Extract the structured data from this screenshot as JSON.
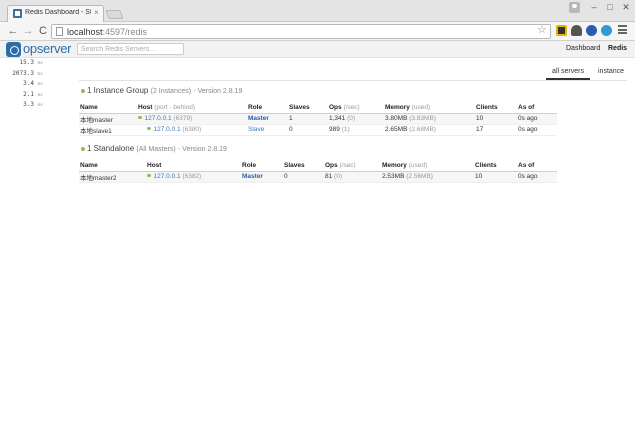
{
  "browser": {
    "tab_title": "Redis Dashboard - Stac",
    "tab_close": "×",
    "url_host": "localhost",
    "url_path": ":4597/redis",
    "win_min": "–",
    "win_max": "□",
    "win_close": "✕",
    "nav_back": "←",
    "nav_forward": "→",
    "nav_reload": "C",
    "star": "☆"
  },
  "header": {
    "logo_text": "opserver",
    "search_placeholder": "Search Redis Servers...",
    "nav": {
      "dashboard": "Dashboard",
      "redis": "Redis"
    }
  },
  "stats": [
    {
      "value": "15.3",
      "unit": "ms"
    },
    {
      "value": "2073.3",
      "unit": "ms"
    },
    {
      "value": "3.4",
      "unit": "ms"
    },
    {
      "value": "2.1",
      "unit": "ms"
    },
    {
      "value": "3.3",
      "unit": "ms"
    }
  ],
  "view_tabs": {
    "all": "all servers",
    "instance": "instance"
  },
  "groups": [
    {
      "title": "1 Instance Group",
      "subtitle": "(2 Instances)",
      "version": "- Version 2.8.19",
      "columns": {
        "name": "Name",
        "host": "Host",
        "host_sub": "(port - behind)",
        "role": "Role",
        "slaves": "Slaves",
        "ops": "Ops",
        "ops_sub": "(/sec)",
        "memory": "Memory",
        "memory_sub": "(used)",
        "clients": "Clients",
        "as_of": "As of"
      },
      "rows": [
        {
          "name": "本地master",
          "host": "127.0.0.1",
          "port": "(6379)",
          "role": "Master",
          "slaves": "1",
          "ops": "1,341",
          "ops_sub": "(0)",
          "memory": "3.80MB",
          "memory_sub": "(3.83MB)",
          "clients": "10",
          "as_of": "0s ago"
        },
        {
          "name": "本地slave1",
          "host": "127.0.0.1",
          "port": "(6380)",
          "role": "Slave",
          "slaves": "0",
          "ops": "989",
          "ops_sub": "(1)",
          "memory": "2.65MB",
          "memory_sub": "(2.68MB)",
          "clients": "17",
          "as_of": "0s ago"
        }
      ]
    },
    {
      "title": "1 Standalone",
      "subtitle": "(All Masters)",
      "version": "- Version 2.8.19",
      "columns": {
        "name": "Name",
        "host": "Host",
        "role": "Role",
        "slaves": "Slaves",
        "ops": "Ops",
        "ops_sub": "(/sec)",
        "memory": "Memory",
        "memory_sub": "(used)",
        "clients": "Clients",
        "as_of": "As of"
      },
      "rows": [
        {
          "name": "本地master2",
          "host": "127.0.0.1",
          "port": "(6382)",
          "role": "Master",
          "slaves": "0",
          "ops": "81",
          "ops_sub": "(0)",
          "memory": "2.53MB",
          "memory_sub": "(2.56MB)",
          "clients": "10",
          "as_of": "0s ago"
        }
      ]
    }
  ],
  "colors": {
    "brand": "#2b6ea8",
    "link": "#3a78b8",
    "status_ok": "#8cc152"
  }
}
